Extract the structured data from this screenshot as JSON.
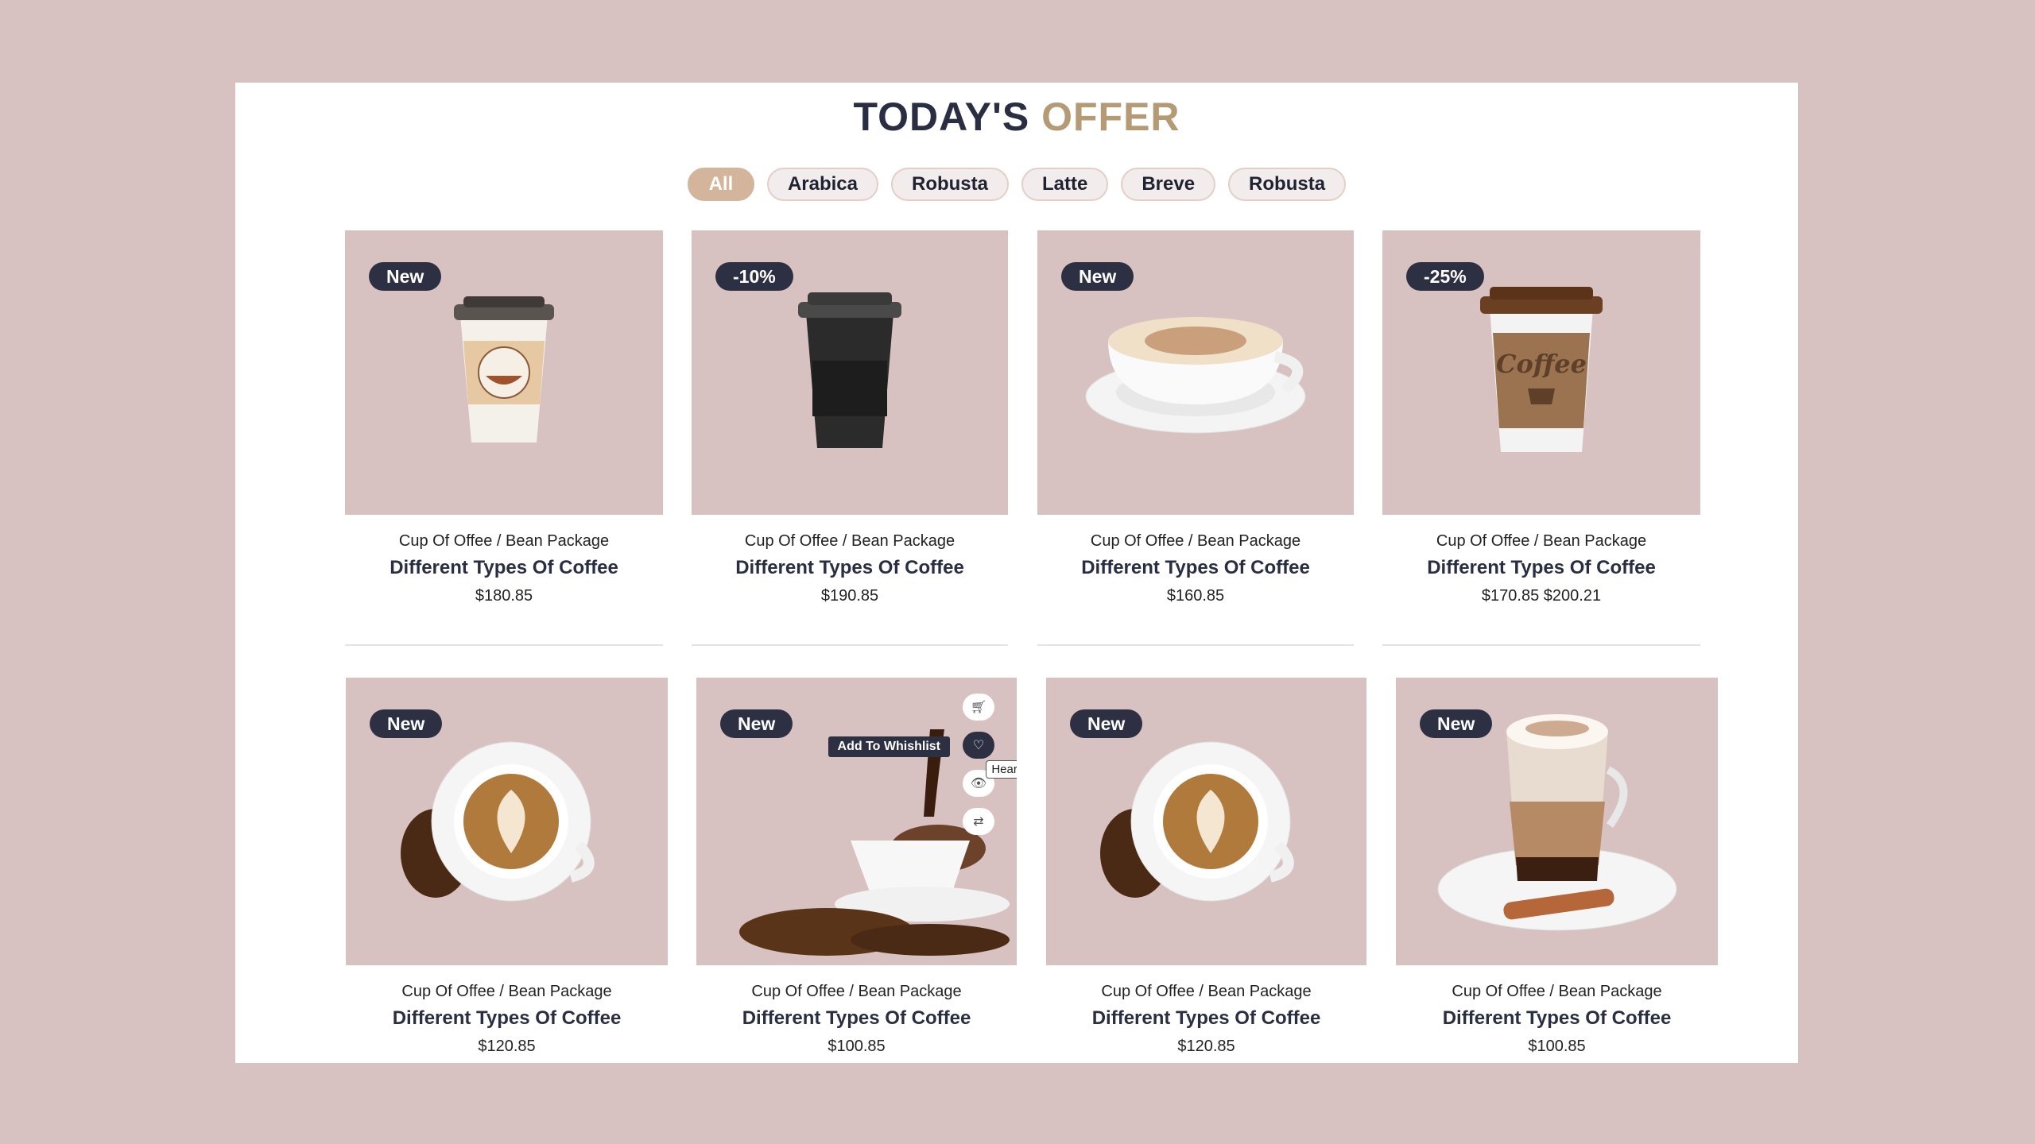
{
  "title": {
    "main": "TODAY'S",
    "accent": "OFFER"
  },
  "colors": {
    "background": "#d8c1c1",
    "accent": "#b59a76",
    "dark": "#2c3042",
    "active_pill": "#d2b59a"
  },
  "filters": [
    {
      "label": "All",
      "active": true
    },
    {
      "label": "Arabica"
    },
    {
      "label": "Robusta"
    },
    {
      "label": "Latte"
    },
    {
      "label": "Breve"
    },
    {
      "label": "Robusta"
    }
  ],
  "products": [
    {
      "badge": "New",
      "category": "Cup Of Offee / Bean Package",
      "name": "Different Types Of Coffee",
      "price": "$180.85",
      "image": "coffee-to-go-cup"
    },
    {
      "badge": "-10%",
      "category": "Cup Of Offee / Bean Package",
      "name": "Different Types Of Coffee",
      "price": "$190.85",
      "image": "black-travel-cup"
    },
    {
      "badge": "New",
      "category": "Cup Of Offee / Bean Package",
      "name": "Different Types Of Coffee",
      "price": "$160.85",
      "image": "cappuccino-cup"
    },
    {
      "badge": "-25%",
      "category": "Cup Of Offee / Bean Package",
      "name": "Different Types Of Coffee",
      "price": "$170.85 $200.21",
      "image": "kraft-coffee-cup"
    },
    {
      "badge": "New",
      "category": "Cup Of Offee / Bean Package",
      "name": "Different Types Of Coffee",
      "price": "$120.85",
      "image": "latte-art-cup"
    },
    {
      "badge": "New",
      "category": "Cup Of Offee / Bean Package",
      "name": "Different Types Of Coffee",
      "price": "$100.85",
      "image": "pouring-coffee-splash"
    },
    {
      "badge": "New",
      "category": "Cup Of Offee / Bean Package",
      "name": "Different Types Of Coffee",
      "price": "$120.85",
      "image": "latte-art-cup"
    },
    {
      "badge": "New",
      "category": "Cup Of Offee / Bean Package",
      "name": "Different Types Of Coffee",
      "price": "$100.85",
      "image": "layered-latte-glass"
    }
  ],
  "hover_actions": {
    "icons": [
      "cart-icon",
      "heart-icon",
      "eye-icon",
      "compare-icon"
    ],
    "wishlist_tooltip": "Add To Whishlist",
    "heart_tooltip": "Heart"
  }
}
